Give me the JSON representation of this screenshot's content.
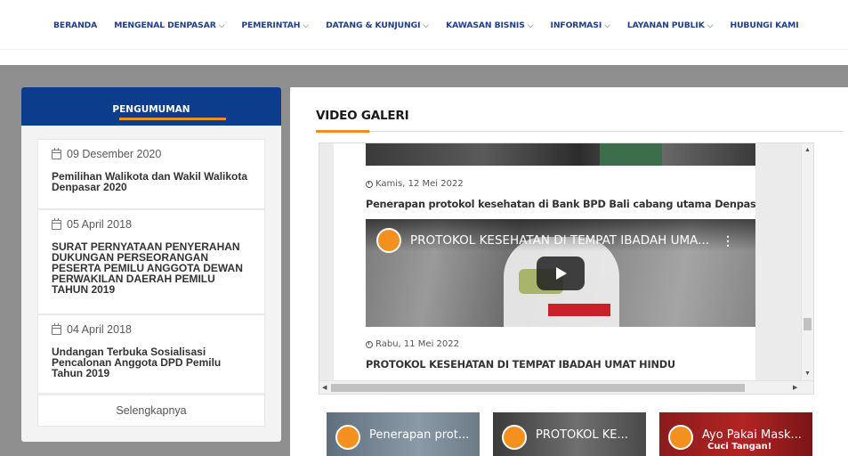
{
  "nav": {
    "items": [
      {
        "label": "BERANDA",
        "dropdown": false
      },
      {
        "label": "MENGENAL DENPASAR",
        "dropdown": true
      },
      {
        "label": "PEMERINTAH",
        "dropdown": true
      },
      {
        "label": "DATANG & KUNJUNGI",
        "dropdown": true
      },
      {
        "label": "KAWASAN BISNIS",
        "dropdown": true
      },
      {
        "label": "INFORMASI",
        "dropdown": true
      },
      {
        "label": "LAYANAN PUBLIK",
        "dropdown": true
      },
      {
        "label": "HUBUNGI KAMI",
        "dropdown": false
      }
    ],
    "chevron": "⌵"
  },
  "announcements": {
    "title": "PENGUMUMAN",
    "items": [
      {
        "date": "09 Desember 2020",
        "title": "Pemilihan Walikota dan Wakil Walikota Denpasar 2020"
      },
      {
        "date": "05 April 2018",
        "title": "SURAT PERNYATAAN PENYERAHAN DUKUNGAN PERSEORANGAN PESERTA PEMILU ANGGOTA DEWAN PERWAKILAN DAERAH PEMILU TAHUN 2019"
      },
      {
        "date": "04 April 2018",
        "title": "Undangan Terbuka Sosialisasi Pencalonan Anggota DPD Pemilu Tahun 2019"
      }
    ],
    "more_label": "Selengkapnya"
  },
  "video_gallery": {
    "title": "VIDEO GALERI",
    "entries": [
      {
        "date": "Kamis, 12 Mei 2022",
        "title": "Penerapan protokol kesehatan di Bank BPD Bali cabang utama Denpasar"
      },
      {
        "date": "Rabu, 11 Mei 2022",
        "title": "PROTOKOL KESEHATAN DI TEMPAT IBADAH UMAT HINDU"
      }
    ],
    "player_title": "PROTOKOL KESEHATAN DI TEMPAT IBADAH UMA...",
    "thumbnails": [
      {
        "title": "Penerapan prot...",
        "sub": ""
      },
      {
        "title": "PROTOKOL KE...",
        "sub": ""
      },
      {
        "title": "Ayo Pakai Mask...",
        "sub": "Cuci Tangan!"
      }
    ]
  },
  "colors": {
    "nav_text": "#1d3d8f",
    "panel_header": "#0c3c8c",
    "accent": "#f28c1f",
    "band": "#8f8f8f"
  },
  "icons": {
    "announcement_date": "calendar-icon",
    "video_date": "clock-icon",
    "video_play": "play-icon",
    "video_menu": "more-vertical-icon"
  }
}
